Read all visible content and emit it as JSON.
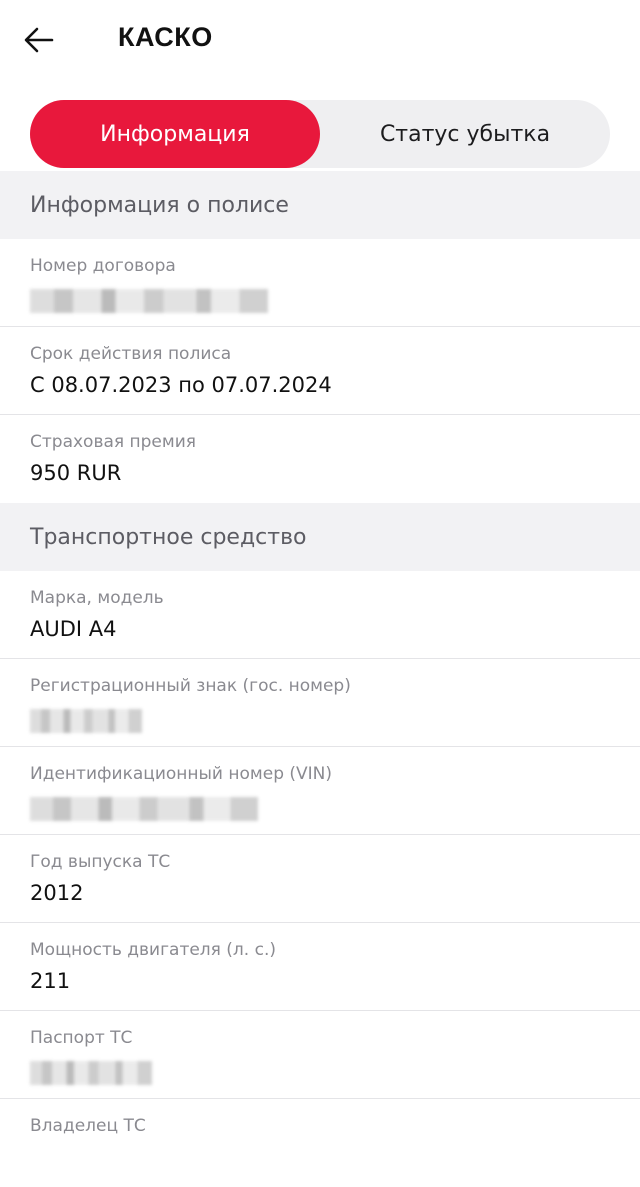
{
  "header": {
    "title": "КАСКО",
    "back_icon": "arrow-left-icon"
  },
  "tabs": [
    {
      "label": "Информация",
      "active": true
    },
    {
      "label": "Статус убытка",
      "active": false
    }
  ],
  "colors": {
    "accent": "#e8183c",
    "section_bg": "#f2f2f4",
    "tabs_bg": "#efeff1"
  },
  "sections": {
    "policy": {
      "title": "Информация о полисе",
      "contract_label": "Номер договора",
      "period_label": "Срок действия полиса",
      "period_value": "С 08.07.2023 по 07.07.2024",
      "premium_label": "Страховая премия",
      "premium_value": "950 RUR"
    },
    "vehicle": {
      "title": "Транспортное средство",
      "model_label": "Марка, модель",
      "model_value": "AUDI A4",
      "plate_label": "Регистрационный знак (гос. номер)",
      "vin_label": "Идентификационный номер (VIN)",
      "year_label": "Год выпуска ТС",
      "year_value": "2012",
      "power_label": "Мощность двигателя (л. с.)",
      "power_value": "211",
      "passport_label": "Паспорт ТС",
      "owner_label": "Владелец ТС"
    }
  }
}
